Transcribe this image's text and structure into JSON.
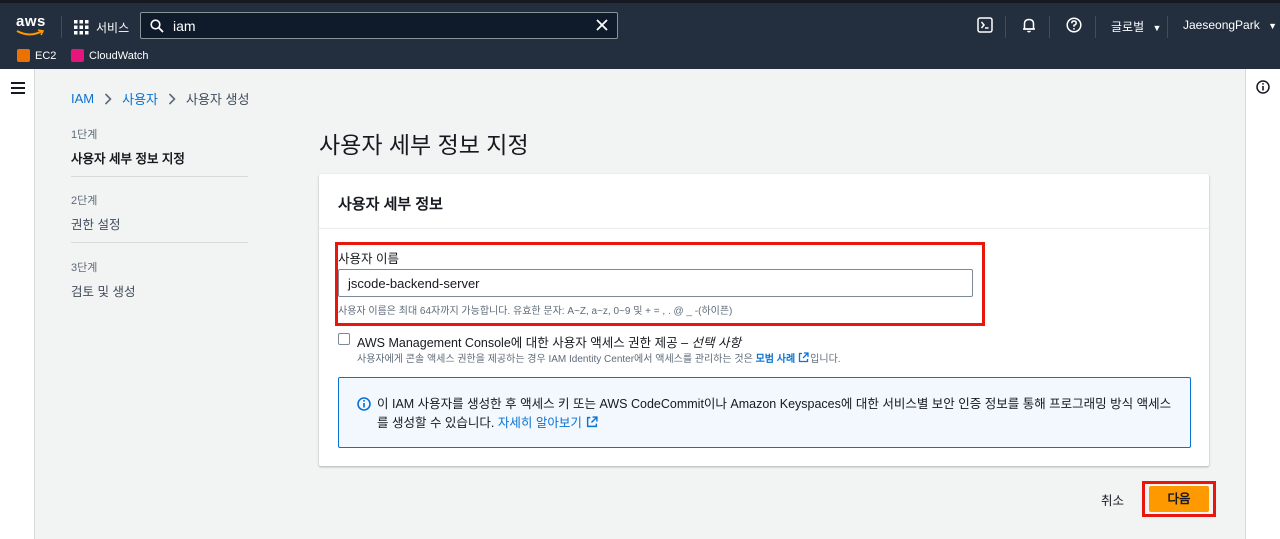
{
  "header": {
    "logo_text": "aws",
    "services_label": "서비스",
    "search_value": "iam",
    "region_label": "글로벌",
    "account_label": "JaeseongPark"
  },
  "favorites": [
    {
      "label": "EC2",
      "color": "#ed7100"
    },
    {
      "label": "CloudWatch",
      "color": "#e7157b"
    }
  ],
  "breadcrumb": {
    "items": [
      "IAM",
      "사용자",
      "사용자 생성"
    ]
  },
  "steps": [
    {
      "number": "1단계",
      "label": "사용자 세부 정보 지정",
      "active": true
    },
    {
      "number": "2단계",
      "label": "권한 설정",
      "active": false
    },
    {
      "number": "3단계",
      "label": "검토 및 생성",
      "active": false
    }
  ],
  "page_title": "사용자 세부 정보 지정",
  "panel": {
    "title": "사용자 세부 정보",
    "username_label": "사용자 이름",
    "username_value": "jscode-backend-server",
    "username_hint": "사용자 이름은 최대 64자까지 가능합니다. 유효한 문자: A~Z, a~z, 0~9 및 + = , . @ _ -(하이픈)",
    "console_access_label": "AWS Management Console에 대한 사용자 액세스 권한 제공 – ",
    "console_access_optional": "선택 사항",
    "console_access_desc": "사용자에게 콘솔 액세스 권한을 제공하는 경우 IAM Identity Center에서 액세스를 관리하는 것은 ",
    "console_access_link": "모범 사례",
    "console_access_desc_end": "입니다.",
    "info_text": "이 IAM 사용자를 생성한 후 액세스 키 또는 AWS CodeCommit이나 Amazon Keyspaces에 대한 서비스별 보안 인증 정보를 통해 프로그래밍 방식 액세스를 생성할 수 있습니다. ",
    "info_link": "자세히 알아보기"
  },
  "actions": {
    "cancel_label": "취소",
    "next_label": "다음"
  },
  "colors": {
    "nav_bg": "#232f3e",
    "accent_orange": "#ff9900",
    "link_blue": "#0972d3",
    "highlight_red": "#e8160c"
  }
}
